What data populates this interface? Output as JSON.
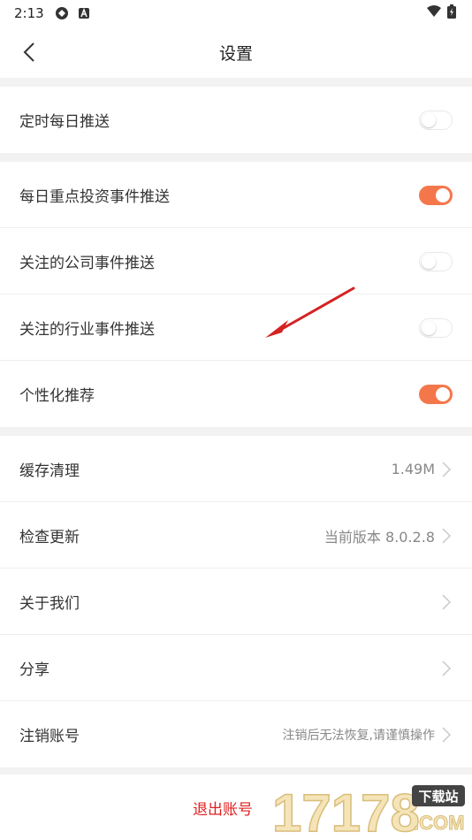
{
  "status_bar": {
    "time": "2:13"
  },
  "header": {
    "title": "设置"
  },
  "section1": {
    "items": [
      {
        "label": "定时每日推送",
        "on": false
      }
    ]
  },
  "section2": {
    "items": [
      {
        "label": "每日重点投资事件推送",
        "on": true
      },
      {
        "label": "关注的公司事件推送",
        "on": false
      },
      {
        "label": "关注的行业事件推送",
        "on": false
      },
      {
        "label": "个性化推荐",
        "on": true
      }
    ]
  },
  "section3": {
    "items": [
      {
        "label": "缓存清理",
        "value": "1.49M"
      },
      {
        "label": "检查更新",
        "value": "当前版本 8.0.2.8"
      },
      {
        "label": "关于我们",
        "value": ""
      },
      {
        "label": "分享",
        "value": ""
      },
      {
        "label": "注销账号",
        "value": "注销后无法恢复,请谨慎操作"
      }
    ]
  },
  "footer": {
    "logout_label": "退出账号"
  },
  "watermark": {
    "number": "17178",
    "tag": "下载站",
    "domain": ".COM"
  },
  "colors": {
    "accent": "#f4774c",
    "logout": "#e02020",
    "arrow": "#d42222",
    "divider_bg": "#f2f2f2"
  }
}
